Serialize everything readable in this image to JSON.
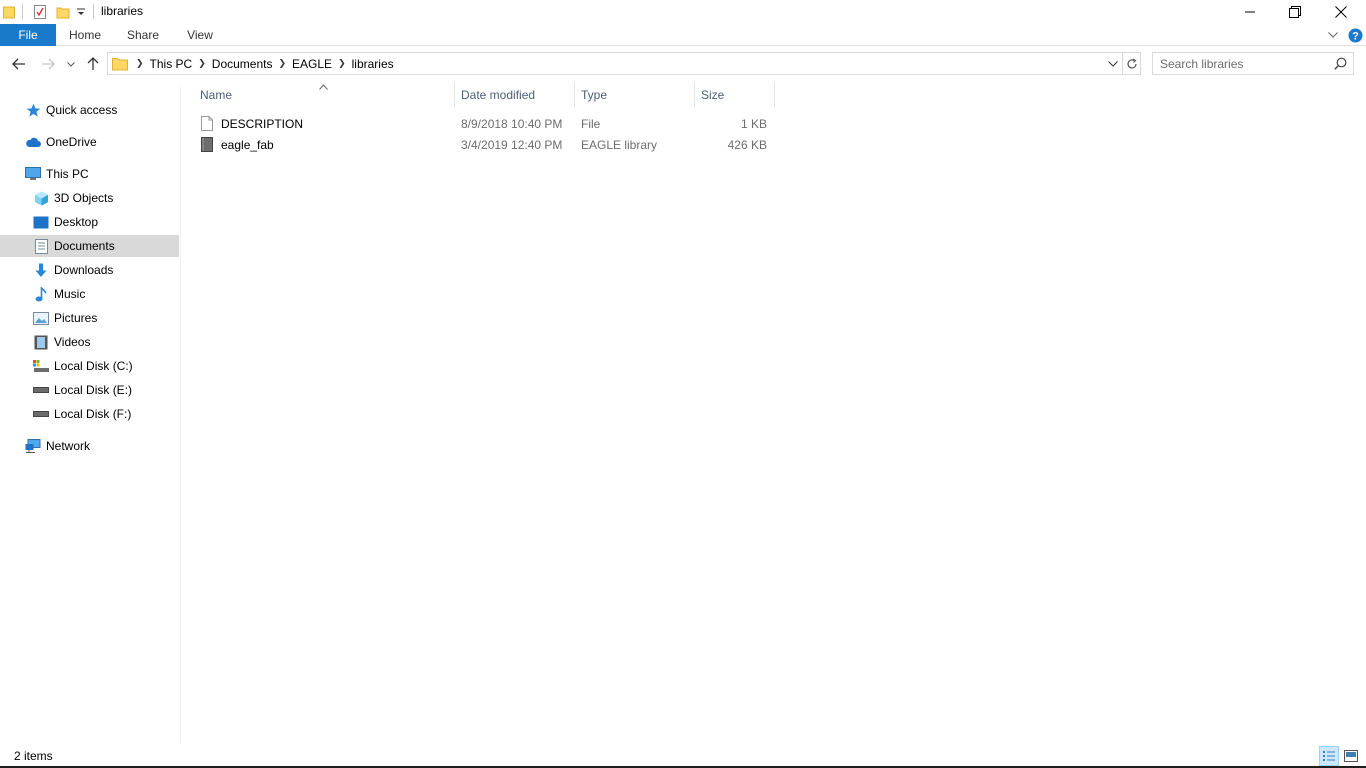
{
  "window": {
    "title": "libraries"
  },
  "ribbon": {
    "tabs": [
      "File",
      "Home",
      "Share",
      "View"
    ]
  },
  "address": {
    "crumbs": [
      "This PC",
      "Documents",
      "EAGLE",
      "libraries"
    ]
  },
  "search": {
    "placeholder": "Search libraries"
  },
  "nav": {
    "items": [
      {
        "label": "Quick access",
        "icon": "star-icon"
      },
      {
        "label": "OneDrive",
        "icon": "cloud-icon"
      },
      {
        "label": "This PC",
        "icon": "computer-icon"
      },
      {
        "label": "3D Objects",
        "icon": "cube-icon"
      },
      {
        "label": "Desktop",
        "icon": "desktop-icon"
      },
      {
        "label": "Documents",
        "icon": "document-icon",
        "selected": true
      },
      {
        "label": "Downloads",
        "icon": "download-icon"
      },
      {
        "label": "Music",
        "icon": "music-icon"
      },
      {
        "label": "Pictures",
        "icon": "pictures-icon"
      },
      {
        "label": "Videos",
        "icon": "video-icon"
      },
      {
        "label": "Local Disk (C:)",
        "icon": "system-drive-icon"
      },
      {
        "label": "Local Disk (E:)",
        "icon": "drive-icon"
      },
      {
        "label": "Local Disk (F:)",
        "icon": "drive-icon"
      },
      {
        "label": "Network",
        "icon": "network-icon"
      }
    ]
  },
  "columns": {
    "name": "Name",
    "date": "Date modified",
    "type": "Type",
    "size": "Size"
  },
  "files": [
    {
      "name": "DESCRIPTION",
      "date": "8/9/2018 10:40 PM",
      "type": "File",
      "size": "1 KB",
      "icon": "file-icon"
    },
    {
      "name": "eagle_fab",
      "date": "3/4/2019 12:40 PM",
      "type": "EAGLE library",
      "size": "426 KB",
      "icon": "eagle-library-icon"
    }
  ],
  "status": {
    "item_count": "2 items"
  },
  "colors": {
    "accent": "#1979ca",
    "selected_nav": "#d9d9d9",
    "header_text": "#4c607a",
    "secondary_text": "#6d6d6d"
  }
}
